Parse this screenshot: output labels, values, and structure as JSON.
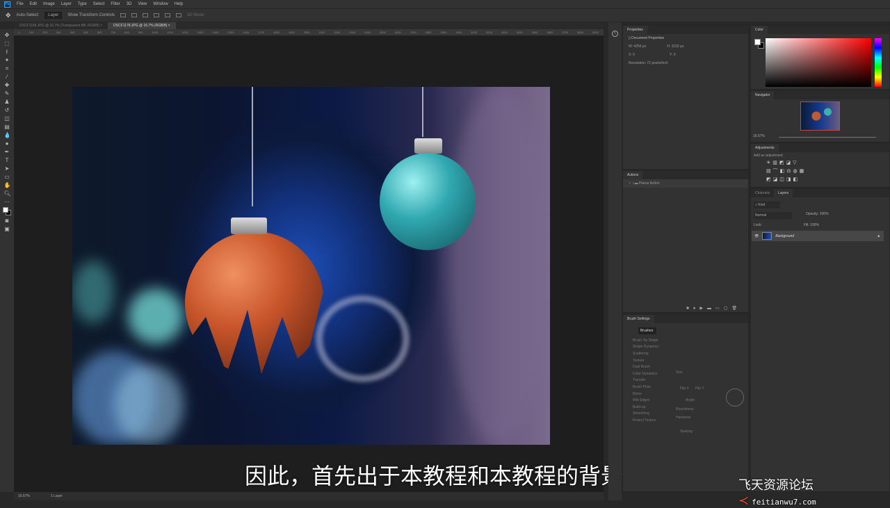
{
  "menu": [
    "File",
    "Edit",
    "Image",
    "Layer",
    "Type",
    "Select",
    "Filter",
    "3D",
    "View",
    "Window",
    "Help"
  ],
  "options": {
    "auto_select": "Auto-Select:",
    "layer_select": "Layer",
    "transform": "Show Transform Controls",
    "mode3d": "3D Mode:"
  },
  "tabs": [
    {
      "label": "DSCF1168.JPG @ 16.7% (Transparent Bill, RGB/8) ×"
    },
    {
      "label": "DSCF1178.JPG @ 16.7% (RGB/8) ×"
    }
  ],
  "ruler": [
    "0",
    "100",
    "200",
    "300",
    "400",
    "500",
    "600",
    "700",
    "800",
    "900",
    "1000",
    "1100",
    "1200",
    "1300",
    "1400",
    "1500",
    "1600",
    "1700",
    "1800",
    "1900",
    "2000",
    "2100",
    "2200",
    "2300",
    "2400",
    "2500",
    "2600",
    "2700",
    "2800",
    "2900",
    "3000",
    "3100",
    "3200",
    "3300",
    "3400",
    "3500",
    "3600",
    "3700",
    "3800",
    "3900"
  ],
  "status": {
    "zoom": "16.67%",
    "doc": "1 Layer"
  },
  "properties": {
    "title": "Properties",
    "doc": "Document Properties",
    "w": "W: 4256 px",
    "h": "H: 3192 px",
    "x": "X: 0",
    "y": "Y: 0",
    "resolution": "Resolution: 72 pixels/inch"
  },
  "actions": {
    "title": "Actions",
    "item": "Planar Action"
  },
  "brush": {
    "title": "Brush Settings",
    "brushes_btn": "Brushes",
    "items": [
      "Brush Tip Shape",
      "Shape Dynamics",
      "Scattering",
      "Texture",
      "Dual Brush",
      "Color Dynamics",
      "Transfer",
      "Brush Pose",
      "Noise",
      "Wet Edges",
      "Build-up",
      "Smoothing",
      "Protect Texture"
    ],
    "size": "Size",
    "flipx": "Flip X",
    "flipy": "Flip Y",
    "angle": "Angle:",
    "roundness": "Roundness:",
    "hardness": "Hardness",
    "spacing": "Spacing"
  },
  "color": {
    "title": "Color",
    "fg": "#ffffff",
    "bg": "#000000"
  },
  "navigator": {
    "title": "Navigator",
    "zoom": "16.67%"
  },
  "adjustments": {
    "title": "Adjustments",
    "hint": "Add an adjustment"
  },
  "layers": {
    "tab_channels": "Channels",
    "tab_layers": "Layers",
    "filter": "Kind",
    "blend": "Normal",
    "opacity": "Opacity: 100%",
    "lock": "Lock:",
    "fill": "Fill: 100%",
    "layer_name": "Background"
  },
  "subtitle": "因此，首先出于本教程和本教程的背景，",
  "watermark": {
    "name": "飞天资源论坛",
    "url": "feitianwu7.com"
  }
}
